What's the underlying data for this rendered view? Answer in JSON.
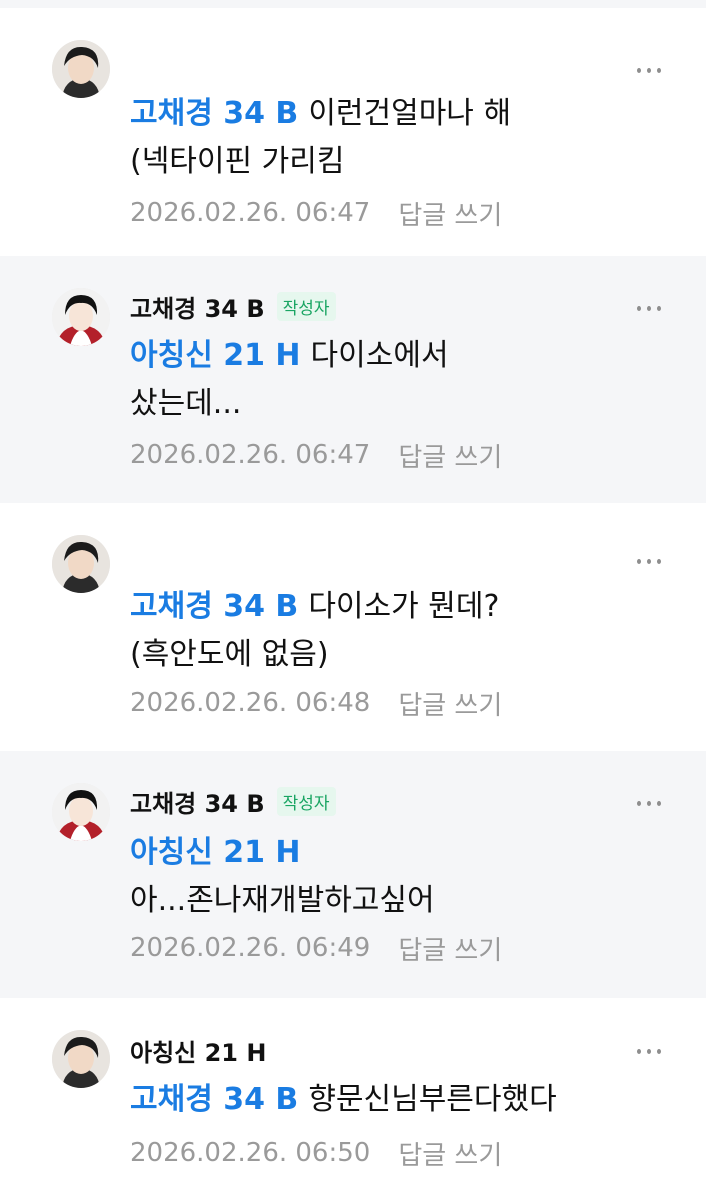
{
  "comments": [
    {
      "nickname": "",
      "author_badge": "",
      "mention": "고채경 34 B",
      "text_lines": [
        "이런건얼마나 해",
        "(넥타이핀 가리킴"
      ],
      "timestamp": "2026.02.26. 06:47",
      "reply_label": "답글 쓰기"
    },
    {
      "nickname": "고채경 34 B",
      "author_badge": "작성자",
      "mention": "아칭신 21 H",
      "text_lines": [
        "다이소에서",
        "샀는데..."
      ],
      "timestamp": "2026.02.26. 06:47",
      "reply_label": "답글 쓰기"
    },
    {
      "nickname": "",
      "author_badge": "",
      "mention": "고채경 34 B",
      "text_lines": [
        "다이소가 뭔데?",
        "(흑안도에 없음)"
      ],
      "timestamp": "2026.02.26. 06:48",
      "reply_label": "답글 쓰기"
    },
    {
      "nickname": "고채경 34 B",
      "author_badge": "작성자",
      "mention": "아칭신 21 H",
      "text_lines": [
        "",
        "아...존나재개발하고싶어"
      ],
      "timestamp": "2026.02.26. 06:49",
      "reply_label": "답글 쓰기"
    },
    {
      "nickname": "아칭신 21 H",
      "author_badge": "",
      "mention": "고채경 34 B",
      "text_lines": [
        "향문신님부른다했다"
      ],
      "timestamp": "2026.02.26. 06:50",
      "reply_label": "답글 쓰기"
    }
  ],
  "colors": {
    "mention": "#1a7ce2",
    "author_badge_text": "#1aa563",
    "author_badge_bg": "#e6f7ee",
    "timestamp": "#9a9a9a",
    "shaded_background": "#f5f6f8"
  },
  "icons": {
    "more": "more-options-icon",
    "avatar": "avatar"
  }
}
